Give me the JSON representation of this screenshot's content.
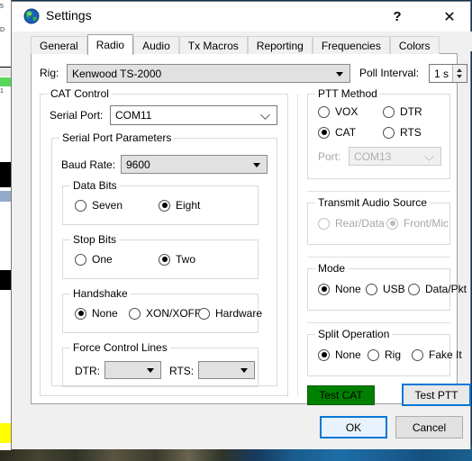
{
  "window": {
    "title": "Settings",
    "icon": "globe-icon",
    "help_label": "?",
    "close_label": "✕"
  },
  "tabs": [
    {
      "label": "General",
      "active": false
    },
    {
      "label": "Radio",
      "active": true
    },
    {
      "label": "Audio",
      "active": false
    },
    {
      "label": "Tx Macros",
      "active": false
    },
    {
      "label": "Reporting",
      "active": false
    },
    {
      "label": "Frequencies",
      "active": false
    },
    {
      "label": "Colors",
      "active": false
    }
  ],
  "rig": {
    "label": "Rig:",
    "value": "Kenwood TS-2000",
    "poll_label": "Poll Interval:",
    "poll_value": "1 s"
  },
  "cat_control": {
    "title": "CAT Control",
    "serial_port_label": "Serial Port:",
    "serial_port_value": "COM11",
    "params_title": "Serial Port Parameters",
    "baud_label": "Baud Rate:",
    "baud_value": "9600",
    "data_bits": {
      "title": "Data Bits",
      "options": [
        {
          "label": "Seven",
          "selected": false
        },
        {
          "label": "Eight",
          "selected": true
        }
      ]
    },
    "stop_bits": {
      "title": "Stop Bits",
      "options": [
        {
          "label": "One",
          "selected": false
        },
        {
          "label": "Two",
          "selected": true
        }
      ]
    },
    "handshake": {
      "title": "Handshake",
      "options": [
        {
          "label": "None",
          "selected": true
        },
        {
          "label": "XON/XOFF",
          "selected": false
        },
        {
          "label": "Hardware",
          "selected": false
        }
      ]
    },
    "force_control_lines": {
      "title": "Force Control Lines",
      "dtr_label": "DTR:",
      "dtr_value": "",
      "rts_label": "RTS:",
      "rts_value": ""
    }
  },
  "ptt_method": {
    "title": "PTT Method",
    "options": [
      {
        "label": "VOX",
        "selected": false
      },
      {
        "label": "DTR",
        "selected": false
      },
      {
        "label": "CAT",
        "selected": true
      },
      {
        "label": "RTS",
        "selected": false
      }
    ],
    "port_label": "Port:",
    "port_value": "COM13",
    "port_disabled": true
  },
  "transmit_audio_source": {
    "title": "Transmit Audio Source",
    "disabled": true,
    "options": [
      {
        "label": "Rear/Data",
        "selected": false
      },
      {
        "label": "Front/Mic",
        "selected": true
      }
    ]
  },
  "mode": {
    "title": "Mode",
    "options": [
      {
        "label": "None",
        "selected": true
      },
      {
        "label": "USB",
        "selected": false
      },
      {
        "label": "Data/Pkt",
        "selected": false
      }
    ]
  },
  "split_operation": {
    "title": "Split Operation",
    "options": [
      {
        "label": "None",
        "selected": true
      },
      {
        "label": "Rig",
        "selected": false
      },
      {
        "label": "Fake It",
        "selected": false
      }
    ]
  },
  "actions": {
    "test_cat_label": "Test CAT",
    "test_cat_color": "#008000",
    "test_ptt_label": "Test PTT",
    "test_ptt_accent": "#0078d7"
  },
  "footer": {
    "ok_label": "OK",
    "cancel_label": "Cancel"
  }
}
